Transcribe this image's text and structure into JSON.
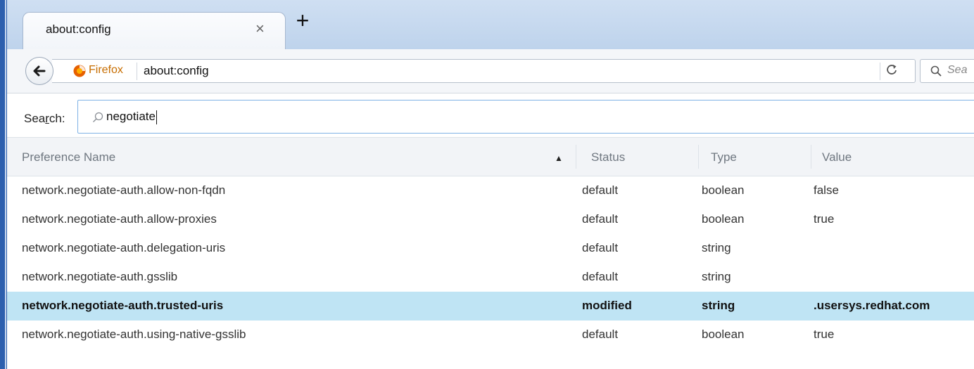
{
  "tab": {
    "title": "about:config",
    "close_glyph": "×",
    "new_tab_glyph": "+"
  },
  "navbar": {
    "identity_label": "Firefox",
    "url": "about:config",
    "reload_glyph": "C",
    "search_placeholder": "Sea"
  },
  "filter": {
    "label_prefix": "Sea",
    "label_accesskey": "r",
    "label_suffix": "ch:",
    "value": "negotiate"
  },
  "table": {
    "columns": [
      "Preference Name",
      "Status",
      "Type",
      "Value"
    ],
    "sort_indicator": "▲",
    "rows": [
      {
        "name": "network.negotiate-auth.allow-non-fqdn",
        "status": "default",
        "type": "boolean",
        "value": "false"
      },
      {
        "name": "network.negotiate-auth.allow-proxies",
        "status": "default",
        "type": "boolean",
        "value": "true"
      },
      {
        "name": "network.negotiate-auth.delegation-uris",
        "status": "default",
        "type": "string",
        "value": ""
      },
      {
        "name": "network.negotiate-auth.gsslib",
        "status": "default",
        "type": "string",
        "value": ""
      },
      {
        "name": "network.negotiate-auth.trusted-uris",
        "status": "modified",
        "type": "string",
        "value": ".usersys.redhat.com"
      },
      {
        "name": "network.negotiate-auth.using-native-gsslib",
        "status": "default",
        "type": "boolean",
        "value": "true"
      }
    ]
  },
  "colors": {
    "highlight_row": "#bfe4f4",
    "firefox_orange": "#e66000",
    "focus_border": "#7fb2e5"
  }
}
